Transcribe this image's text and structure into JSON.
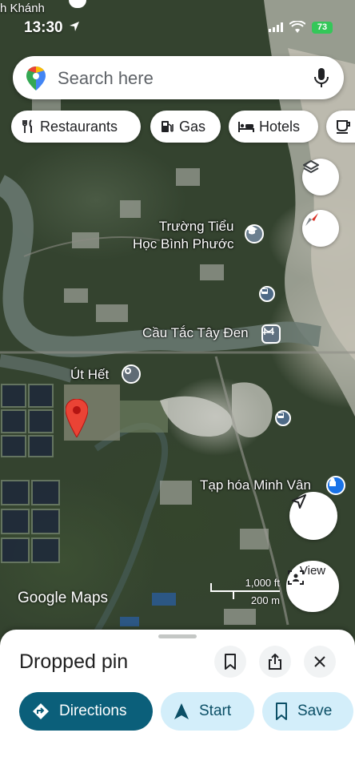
{
  "status_bar": {
    "time": "13:30",
    "battery": "73",
    "top_place_label": "h Khánh"
  },
  "search": {
    "placeholder": "Search here"
  },
  "chips": [
    {
      "label": "Restaurants",
      "icon": "restaurant-icon"
    },
    {
      "label": "Gas",
      "icon": "gas-station-icon"
    },
    {
      "label": "Hotels",
      "icon": "hotel-icon"
    },
    {
      "label": "",
      "icon": "coffee-icon"
    }
  ],
  "map": {
    "labels": {
      "school": "Trường Tiểu\nHọc Bình Phước",
      "bridge": "Cầu Tắc Tây Đen",
      "ut_het": "Út Hết",
      "store": "Tạp hóa Minh Vân"
    },
    "scale_ft": "1,000 ft",
    "scale_m": "200 m",
    "attribution": "Google Maps",
    "view_button": "View",
    "colors": {
      "pin": "#ea4335",
      "poi_school": "#6b7f8f",
      "poi_location": "#5f6b75",
      "poi_store": "#1a73e8"
    }
  },
  "sheet": {
    "title": "Dropped pin",
    "directions": "Directions",
    "start": "Start",
    "save": "Save",
    "colors": {
      "primary": "#0b5f7a",
      "secondary": "#d3eefa"
    }
  }
}
